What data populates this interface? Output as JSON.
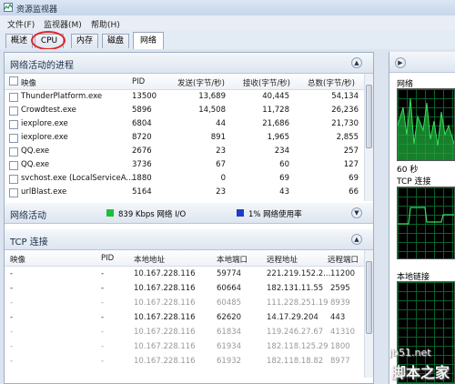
{
  "window": {
    "title": "资源监视器"
  },
  "menu": [
    {
      "label": "文件(F)"
    },
    {
      "label": "监视器(M)"
    },
    {
      "label": "帮助(H)"
    }
  ],
  "tabs": [
    {
      "label": "概述",
      "active": false
    },
    {
      "label": "CPU",
      "active": false
    },
    {
      "label": "内存",
      "active": false
    },
    {
      "label": "磁盘",
      "active": false
    },
    {
      "label": "网络",
      "active": true
    }
  ],
  "processes": {
    "title": "网络活动的进程",
    "columns": [
      "映像",
      "PID",
      "发送(字节/秒)",
      "接收(字节/秒)",
      "总数(字节/秒)"
    ],
    "rows": [
      {
        "name": "ThunderPlatform.exe",
        "pid": "13500",
        "send": "13,689",
        "recv": "40,445",
        "total": "54,134"
      },
      {
        "name": "Crowdtest.exe",
        "pid": "5896",
        "send": "14,508",
        "recv": "11,728",
        "total": "26,236"
      },
      {
        "name": "iexplore.exe",
        "pid": "6804",
        "send": "44",
        "recv": "21,686",
        "total": "21,730"
      },
      {
        "name": "iexplore.exe",
        "pid": "8720",
        "send": "891",
        "recv": "1,965",
        "total": "2,855"
      },
      {
        "name": "QQ.exe",
        "pid": "2676",
        "send": "23",
        "recv": "234",
        "total": "257"
      },
      {
        "name": "QQ.exe",
        "pid": "3736",
        "send": "67",
        "recv": "60",
        "total": "127"
      },
      {
        "name": "svchost.exe (LocalServiceA...",
        "pid": "1880",
        "send": "0",
        "recv": "69",
        "total": "69"
      },
      {
        "name": "urlBlast.exe",
        "pid": "5164",
        "send": "23",
        "recv": "43",
        "total": "66"
      }
    ]
  },
  "network_activity": {
    "title": "网络活动",
    "io_text": "839 Kbps 网络 I/O",
    "usage_text": "1% 网络使用率",
    "io_color": "#1fbf3a",
    "usage_color": "#1e3cc8"
  },
  "tcp": {
    "title": "TCP 连接",
    "columns": [
      "映像",
      "PID",
      "本地地址",
      "本地端口",
      "远程地址",
      "远程端口"
    ],
    "rows": [
      {
        "image": "-",
        "pid": "-",
        "local": "10.167.228.116",
        "lport": "59774",
        "remote": "221.219.152.2...",
        "rport": "11200",
        "dim": false
      },
      {
        "image": "-",
        "pid": "-",
        "local": "10.167.228.116",
        "lport": "60664",
        "remote": "182.131.11.55",
        "rport": "2595",
        "dim": false
      },
      {
        "image": "-",
        "pid": "-",
        "local": "10.167.228.116",
        "lport": "60485",
        "remote": "111.228.251.19",
        "rport": "8939",
        "dim": true
      },
      {
        "image": "-",
        "pid": "-",
        "local": "10.167.228.116",
        "lport": "62620",
        "remote": "14.17.29.204",
        "rport": "443",
        "dim": false
      },
      {
        "image": "-",
        "pid": "-",
        "local": "10.167.228.116",
        "lport": "61834",
        "remote": "119.246.27.67",
        "rport": "41310",
        "dim": true
      },
      {
        "image": "-",
        "pid": "-",
        "local": "10.167.228.116",
        "lport": "61934",
        "remote": "182.118.125.29",
        "rport": "1800",
        "dim": true
      },
      {
        "image": "-",
        "pid": "-",
        "local": "10.167.228.116",
        "lport": "61932",
        "remote": "182.118.18.82",
        "rport": "8977",
        "dim": true
      }
    ]
  },
  "right_panel": {
    "network_label": "网络",
    "time_label": "60 秒",
    "tcp_label": "TCP 连接",
    "local_label": "本地链接"
  },
  "watermark": {
    "line1": "jb51.net",
    "line2": "脚本之家"
  }
}
